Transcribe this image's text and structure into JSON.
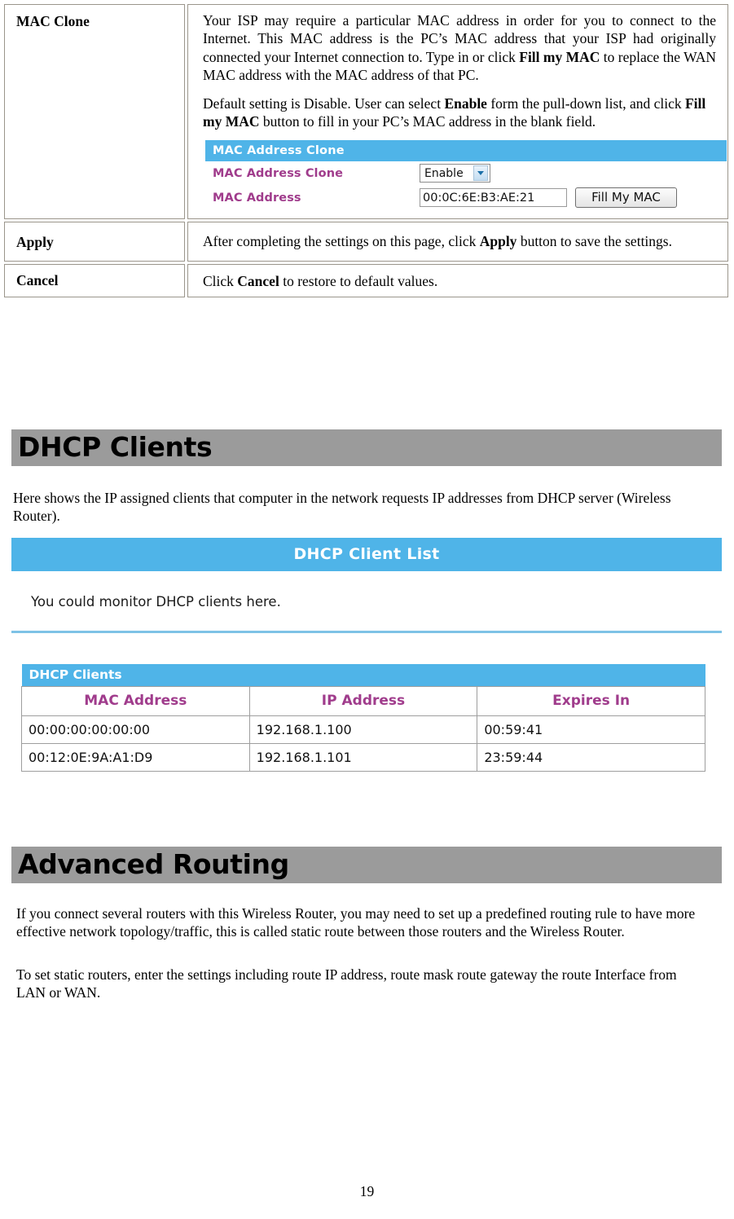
{
  "colors": {
    "section_bar_bg": "#9b9b9b",
    "router_blue": "#4fb4e8",
    "router_label_purple": "#a03c8c",
    "table_border": "#9b968c"
  },
  "mac_clone_table": {
    "rows": [
      {
        "label": "MAC Clone",
        "paragraphs": [
          "Your ISP may require a particular MAC address in order for you to connect to the Internet. This MAC address is the PC’s MAC address that your ISP had originally connected your Internet connection to. Type in or click ",
          "Default setting is Disable. User can select "
        ],
        "p1_bold": "Fill my MAC",
        "p1_tail": " to replace the WAN MAC address with the MAC address of that PC.",
        "p2_bold1": "Enable",
        "p2_mid": " form the pull-down list, and click ",
        "p2_bold2": "Fill my MAC",
        "p2_tail": " button to fill in your PC’s MAC address in the blank field."
      },
      {
        "label": "Apply",
        "text_lead": "After completing the settings on this page, click ",
        "text_bold": "Apply",
        "text_tail": " button to save the settings."
      },
      {
        "label": "Cancel",
        "text_lead": "Click ",
        "text_bold": "Cancel",
        "text_tail": " to restore to default values."
      }
    ]
  },
  "mac_clone_screenshot": {
    "panel_title": "MAC Address Clone",
    "field_label_1": "MAC Address Clone",
    "select_value": "Enable",
    "field_label_2": "MAC Address",
    "mac_value": "00:0C:6E:B3:AE:21",
    "button_label": "Fill My MAC"
  },
  "dhcp_section": {
    "heading": "DHCP Clients",
    "intro": "Here shows the IP assigned clients that computer in the network requests IP addresses from DHCP server (Wireless  Router).",
    "screenshot": {
      "title": "DHCP Client List",
      "note": "You could monitor DHCP clients here.",
      "table_title": "DHCP Clients",
      "columns": [
        "MAC Address",
        "IP Address",
        "Expires In"
      ],
      "rows": [
        [
          "00:00:00:00:00:00",
          "192.168.1.100",
          "00:59:41"
        ],
        [
          "00:12:0E:9A:A1:D9",
          "192.168.1.101",
          "23:59:44"
        ]
      ]
    }
  },
  "routing_section": {
    "heading": "Advanced Routing",
    "paragraph_1": "If you connect several routers with this Wireless  Router, you may need to set up a predefined routing rule to have more effective network topology/traffic, this is called static route between those routers and the Wireless  Router.",
    "paragraph_2": "To set static routers, enter the settings including route IP address, route mask route gateway the route Interface from LAN or WAN."
  },
  "footer": {
    "page_number": "19"
  }
}
